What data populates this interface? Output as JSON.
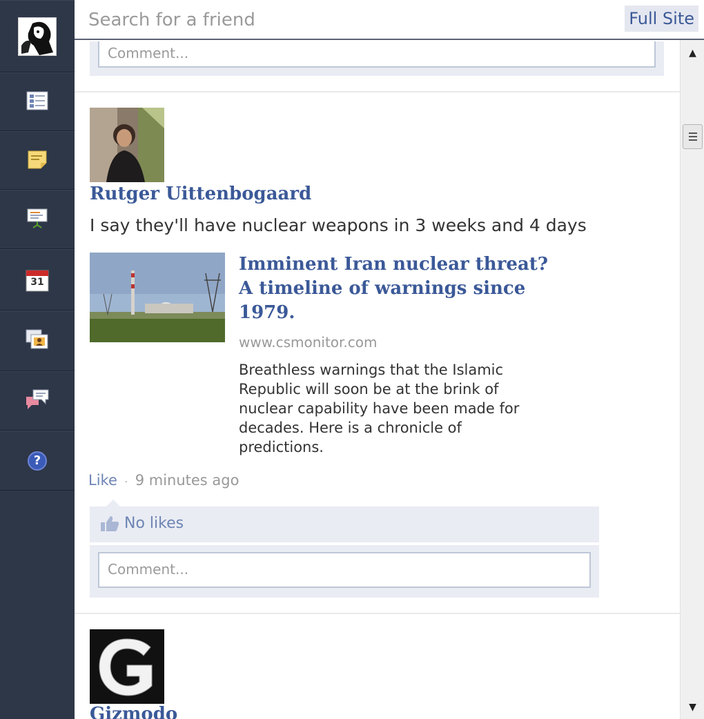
{
  "search": {
    "placeholder": "Search for a friend"
  },
  "header": {
    "full_site_label": "Full Site"
  },
  "sidebar": {
    "items": [
      {
        "icon": "news-feed-icon"
      },
      {
        "icon": "notes-icon"
      },
      {
        "icon": "presentation-icon"
      },
      {
        "icon": "calendar-icon",
        "text": "31"
      },
      {
        "icon": "photos-icon"
      },
      {
        "icon": "chat-icon"
      },
      {
        "icon": "help-icon",
        "text": "?"
      }
    ]
  },
  "feed": {
    "top_comment_placeholder": "Comment...",
    "post": {
      "author": "Rutger Uittenbogaard",
      "status": "I say they'll have nuclear weapons in 3 weeks and 4 days",
      "link": {
        "title": "Imminent Iran nuclear threat? A timeline of warnings since 1979.",
        "domain": "www.csmonitor.com",
        "description": "Breathless warnings that the Islamic Republic will soon be at the brink of nuclear capability have been made for decades. Here is a chronicle of predictions."
      },
      "like_label": "Like",
      "separator": "·",
      "time": "9 minutes ago",
      "likes_text": "No likes",
      "comment_placeholder": "Comment..."
    },
    "next_post": {
      "author": "Gizmodo",
      "avatar_letter": "G"
    }
  },
  "colors": {
    "sidebar_bg": "#2e3748",
    "link_blue": "#3b5998",
    "light_panel": "#e9ecf3"
  }
}
